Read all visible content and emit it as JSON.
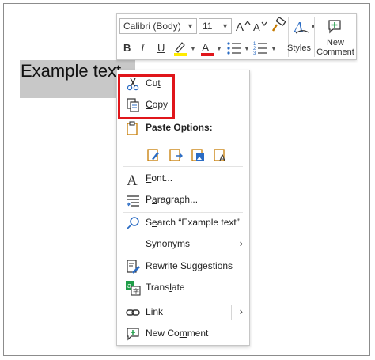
{
  "selection": {
    "text": "Example text"
  },
  "mini_toolbar": {
    "font_name": "Calibri (Body)",
    "font_size": "11",
    "bold": "B",
    "italic": "I",
    "underline": "U",
    "styles_label": "Styles",
    "new_comment_line1": "New",
    "new_comment_line2": "Comment",
    "colors": {
      "font_color": "#e0161b",
      "highlight": "#ffeb00",
      "accent": "#2b6cc4"
    }
  },
  "context_menu": {
    "cut_pre": "Cu",
    "cut_acc": "t",
    "copy_acc": "C",
    "copy_post": "opy",
    "paste_options": "Paste Options:",
    "font_acc": "F",
    "font_post": "ont...",
    "paragraph_pre": "P",
    "paragraph_acc": "a",
    "paragraph_post": "ragraph...",
    "search_pre": "S",
    "search_acc": "e",
    "search_post": "arch “Example text”",
    "synonyms_pre": "S",
    "synonyms_acc": "y",
    "synonyms_post": "nonyms",
    "rewrite": "Rewrite Suggestions",
    "translate_pre": "Trans",
    "translate_acc": "l",
    "translate_post": "ate",
    "link_pre": "L",
    "link_acc": "i",
    "link_post": "nk",
    "new_comment_pre": "New Co",
    "new_comment_acc": "m",
    "new_comment_post": "ment",
    "highlight_color": "#e0161b"
  }
}
